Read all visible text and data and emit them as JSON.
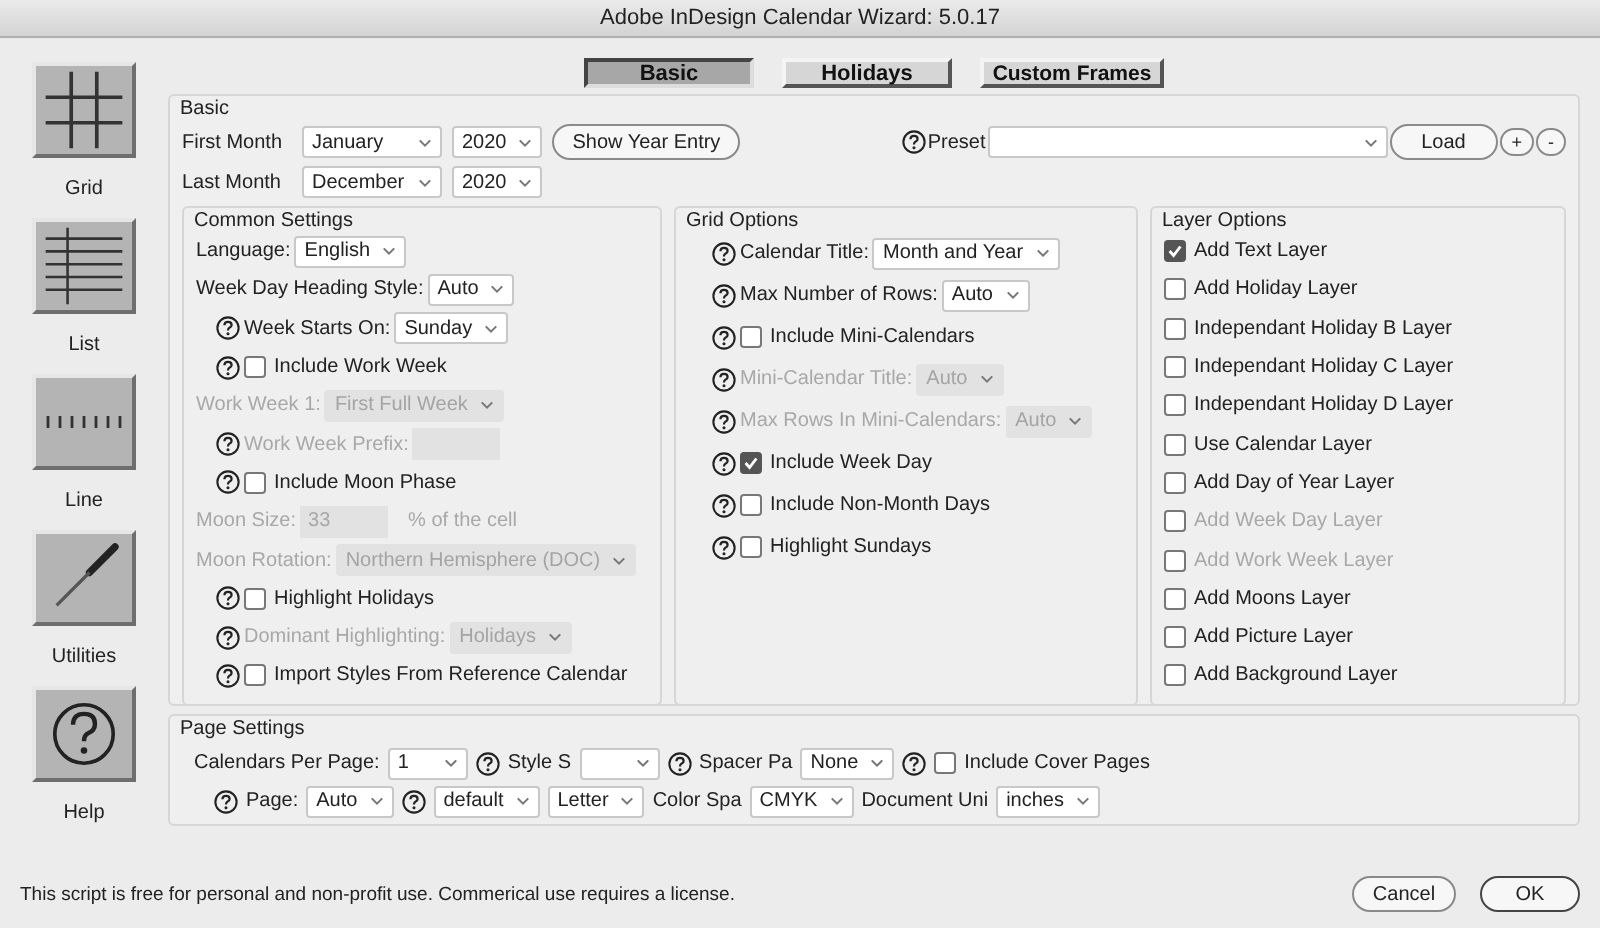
{
  "window": {
    "title": "Adobe InDesign Calendar Wizard: 5.0.17"
  },
  "sidebar": [
    {
      "label": "Grid"
    },
    {
      "label": "List"
    },
    {
      "label": "Line"
    },
    {
      "label": "Utilities"
    },
    {
      "label": "Help"
    }
  ],
  "tabs": [
    {
      "label": "Basic",
      "selected": true
    },
    {
      "label": "Holidays",
      "selected": false
    },
    {
      "label": "Custom Frames",
      "selected": false
    }
  ],
  "basic": {
    "title": "Basic",
    "first_month": {
      "label": "First Month",
      "month": "January",
      "year": "2020"
    },
    "last_month": {
      "label": "Last Month",
      "month": "December",
      "year": "2020"
    },
    "show_year_button": "Show Year Entry",
    "preset": {
      "label": "Preset"
    },
    "load_button": "Load",
    "add_button": "+",
    "remove_button": "-"
  },
  "common_settings": {
    "title": "Common Settings",
    "rows": [
      {
        "disabled": false,
        "items": [
          {
            "kind": "label",
            "text": "Language:"
          },
          {
            "kind": "select",
            "value": "English"
          }
        ]
      },
      {
        "disabled": false,
        "items": [
          {
            "kind": "label",
            "text": "Week Day Heading Style:"
          },
          {
            "kind": "select",
            "value": "Auto"
          }
        ]
      },
      {
        "disabled": false,
        "items": [
          {
            "kind": "help"
          },
          {
            "kind": "label",
            "text": "Week Starts On:"
          },
          {
            "kind": "select",
            "value": "Sunday"
          }
        ]
      },
      {
        "disabled": false,
        "items": [
          {
            "kind": "help"
          },
          {
            "kind": "checkbox",
            "label": "Include Work Week",
            "checked": false
          }
        ]
      },
      {
        "disabled": true,
        "items": [
          {
            "kind": "label",
            "text": "Work Week 1:"
          },
          {
            "kind": "select",
            "value": "First Full Week"
          }
        ]
      },
      {
        "disabled": true,
        "items": [
          {
            "kind": "help"
          },
          {
            "kind": "label",
            "text": "Work Week Prefix:"
          },
          {
            "kind": "input"
          }
        ]
      },
      {
        "disabled": false,
        "items": [
          {
            "kind": "help"
          },
          {
            "kind": "checkbox",
            "label": "Include Moon Phase",
            "checked": false
          }
        ]
      },
      {
        "disabled": true,
        "items": [
          {
            "kind": "label",
            "text": "Moon Size:"
          },
          {
            "kind": "input",
            "value": "33"
          },
          {
            "kind": "label",
            "text": "% of the cell"
          }
        ]
      },
      {
        "disabled": true,
        "items": [
          {
            "kind": "label",
            "text": "Moon Rotation:"
          },
          {
            "kind": "select",
            "value": "Northern Hemisphere (DOC)"
          }
        ]
      },
      {
        "disabled": false,
        "items": [
          {
            "kind": "help"
          },
          {
            "kind": "checkbox",
            "label": "Highlight Holidays",
            "checked": false
          }
        ]
      },
      {
        "disabled": true,
        "items": [
          {
            "kind": "help"
          },
          {
            "kind": "label",
            "text": "Dominant Highlighting:"
          },
          {
            "kind": "select",
            "value": "Holidays"
          }
        ]
      },
      {
        "disabled": false,
        "items": [
          {
            "kind": "help"
          },
          {
            "kind": "checkbox",
            "label": "Import Styles From Reference Calendar",
            "checked": false
          }
        ]
      }
    ]
  },
  "grid_options": {
    "title": "Grid Options",
    "rows": [
      {
        "disabled": false,
        "items": [
          {
            "kind": "help"
          },
          {
            "kind": "label",
            "text": "Calendar Title:"
          },
          {
            "kind": "select",
            "value": "Month and Year"
          }
        ]
      },
      {
        "disabled": false,
        "items": [
          {
            "kind": "help"
          },
          {
            "kind": "label",
            "text": "Max Number of Rows:"
          },
          {
            "kind": "select",
            "value": "Auto"
          }
        ]
      },
      {
        "disabled": false,
        "items": [
          {
            "kind": "help"
          },
          {
            "kind": "checkbox",
            "label": "Include Mini-Calendars",
            "checked": false
          }
        ]
      },
      {
        "disabled": true,
        "items": [
          {
            "kind": "help"
          },
          {
            "kind": "label",
            "text": "Mini-Calendar Title:"
          },
          {
            "kind": "select",
            "value": "Auto"
          }
        ]
      },
      {
        "disabled": true,
        "items": [
          {
            "kind": "help"
          },
          {
            "kind": "label",
            "text": "Max Rows In Mini-Calendars:"
          },
          {
            "kind": "select",
            "value": "Auto"
          }
        ]
      },
      {
        "disabled": false,
        "items": [
          {
            "kind": "help"
          },
          {
            "kind": "checkbox",
            "label": "Include Week Day",
            "checked": true
          }
        ]
      },
      {
        "disabled": false,
        "items": [
          {
            "kind": "help"
          },
          {
            "kind": "checkbox",
            "label": "Include Non-Month Days",
            "checked": false
          }
        ]
      },
      {
        "disabled": false,
        "items": [
          {
            "kind": "help"
          },
          {
            "kind": "checkbox",
            "label": "Highlight Sundays",
            "checked": false
          }
        ]
      }
    ]
  },
  "layer_options": {
    "title": "Layer Options",
    "items": [
      {
        "label": "Add Text Layer",
        "checked": true,
        "disabled": false
      },
      {
        "label": "Add Holiday Layer",
        "checked": false,
        "disabled": false
      },
      {
        "label": "Independant Holiday B Layer",
        "checked": false,
        "disabled": false
      },
      {
        "label": "Independant Holiday C Layer",
        "checked": false,
        "disabled": false
      },
      {
        "label": "Independant Holiday D Layer",
        "checked": false,
        "disabled": false
      },
      {
        "label": "Use Calendar Layer",
        "checked": false,
        "disabled": false
      },
      {
        "label": "Add Day of Year Layer",
        "checked": false,
        "disabled": false
      },
      {
        "label": "Add Week Day Layer",
        "checked": false,
        "disabled": true
      },
      {
        "label": "Add Work Week Layer",
        "checked": false,
        "disabled": true
      },
      {
        "label": "Add Moons Layer",
        "checked": false,
        "disabled": false
      },
      {
        "label": "Add Picture Layer",
        "checked": false,
        "disabled": false
      },
      {
        "label": "Add Background Layer",
        "checked": false,
        "disabled": false
      }
    ]
  },
  "page_settings": {
    "title": "Page Settings",
    "rows": [
      {
        "disabled": false,
        "items": [
          {
            "kind": "label",
            "text": "Calendars Per Page:"
          },
          {
            "kind": "select",
            "value": "1"
          },
          {
            "kind": "help"
          },
          {
            "kind": "label",
            "text": "Style S"
          },
          {
            "kind": "select"
          },
          {
            "kind": "help"
          },
          {
            "kind": "label",
            "text": "Spacer Pa"
          },
          {
            "kind": "select",
            "value": "None"
          },
          {
            "kind": "help"
          },
          {
            "kind": "checkbox",
            "label": "Include Cover Pages",
            "checked": false
          }
        ]
      },
      {
        "disabled": false,
        "items": [
          {
            "kind": "help"
          },
          {
            "kind": "label",
            "text": "Page:"
          },
          {
            "kind": "select",
            "value": "Auto"
          },
          {
            "kind": "help"
          },
          {
            "kind": "select",
            "value": "default"
          },
          {
            "kind": "select",
            "value": "Letter"
          },
          {
            "kind": "label",
            "text": "Color Spa"
          },
          {
            "kind": "select",
            "value": "CMYK"
          },
          {
            "kind": "label",
            "text": "Document Uni"
          },
          {
            "kind": "select",
            "value": "inches"
          }
        ]
      }
    ]
  },
  "footer": {
    "note": "This script is free for personal and non-profit use.  Commerical use requires a license.",
    "cancel_button": "Cancel",
    "ok_button": "OK"
  }
}
